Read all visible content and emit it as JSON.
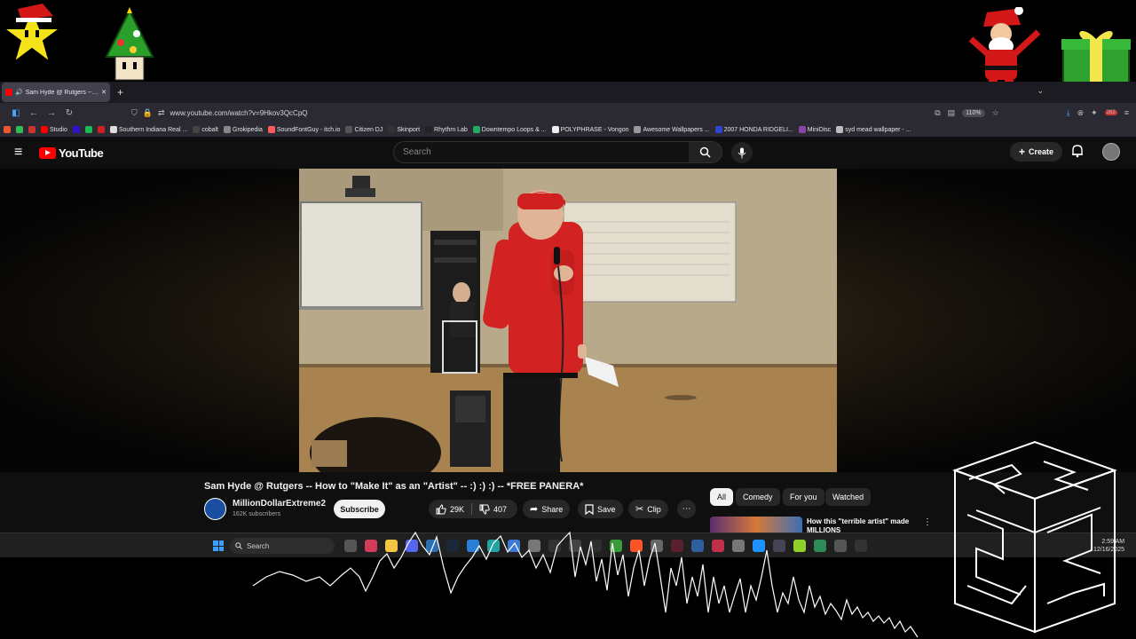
{
  "browser": {
    "tab_title": "Sam Hyde @ Rutgers -- Ho",
    "url": "www.youtube.com/watch?v=9Hkov3QcCpQ",
    "zoom": "110%",
    "bookmarks": [
      "Studio",
      "Southern Indiana Real ...",
      "cobalt",
      "Grokipedia",
      "SoundFontGuy - itch.io",
      "Citizen DJ",
      "Skinport",
      "Rhythm Lab",
      "Downtempo Loops & ...",
      "POLYPHRASE - Vongon",
      "Awesome Wallpapers ...",
      "2007 HONDA RIDGELI...",
      "MiniDisc",
      "syd mead wallpaper - ..."
    ],
    "extension_badge": "282"
  },
  "youtube": {
    "logo_text": "YouTube",
    "search_placeholder": "Search",
    "create_label": "Create"
  },
  "video": {
    "title": "Sam Hyde @ Rutgers -- How to \"Make It\" as an \"Artist\" -- :) :) :) -- *FREE PANERA*",
    "channel_name": "MillionDollarExtreme2",
    "subscribers": "162K subscribers",
    "subscribe_label": "Subscribe",
    "likes": "29K",
    "dislikes": "407",
    "share_label": "Share",
    "save_label": "Save",
    "clip_label": "Clip"
  },
  "recommendations": {
    "chips": [
      "All",
      "Comedy",
      "For you",
      "Watched"
    ],
    "first_title": "How this \"terrible artist\" made MILLIONS"
  },
  "taskbar": {
    "search_label": "Search",
    "time": "2:59 AM",
    "date": "12/16/2025"
  },
  "colors": {
    "youtube_red": "#ff0000",
    "background": "#0f0f0f",
    "shirt_red": "#d32222"
  }
}
